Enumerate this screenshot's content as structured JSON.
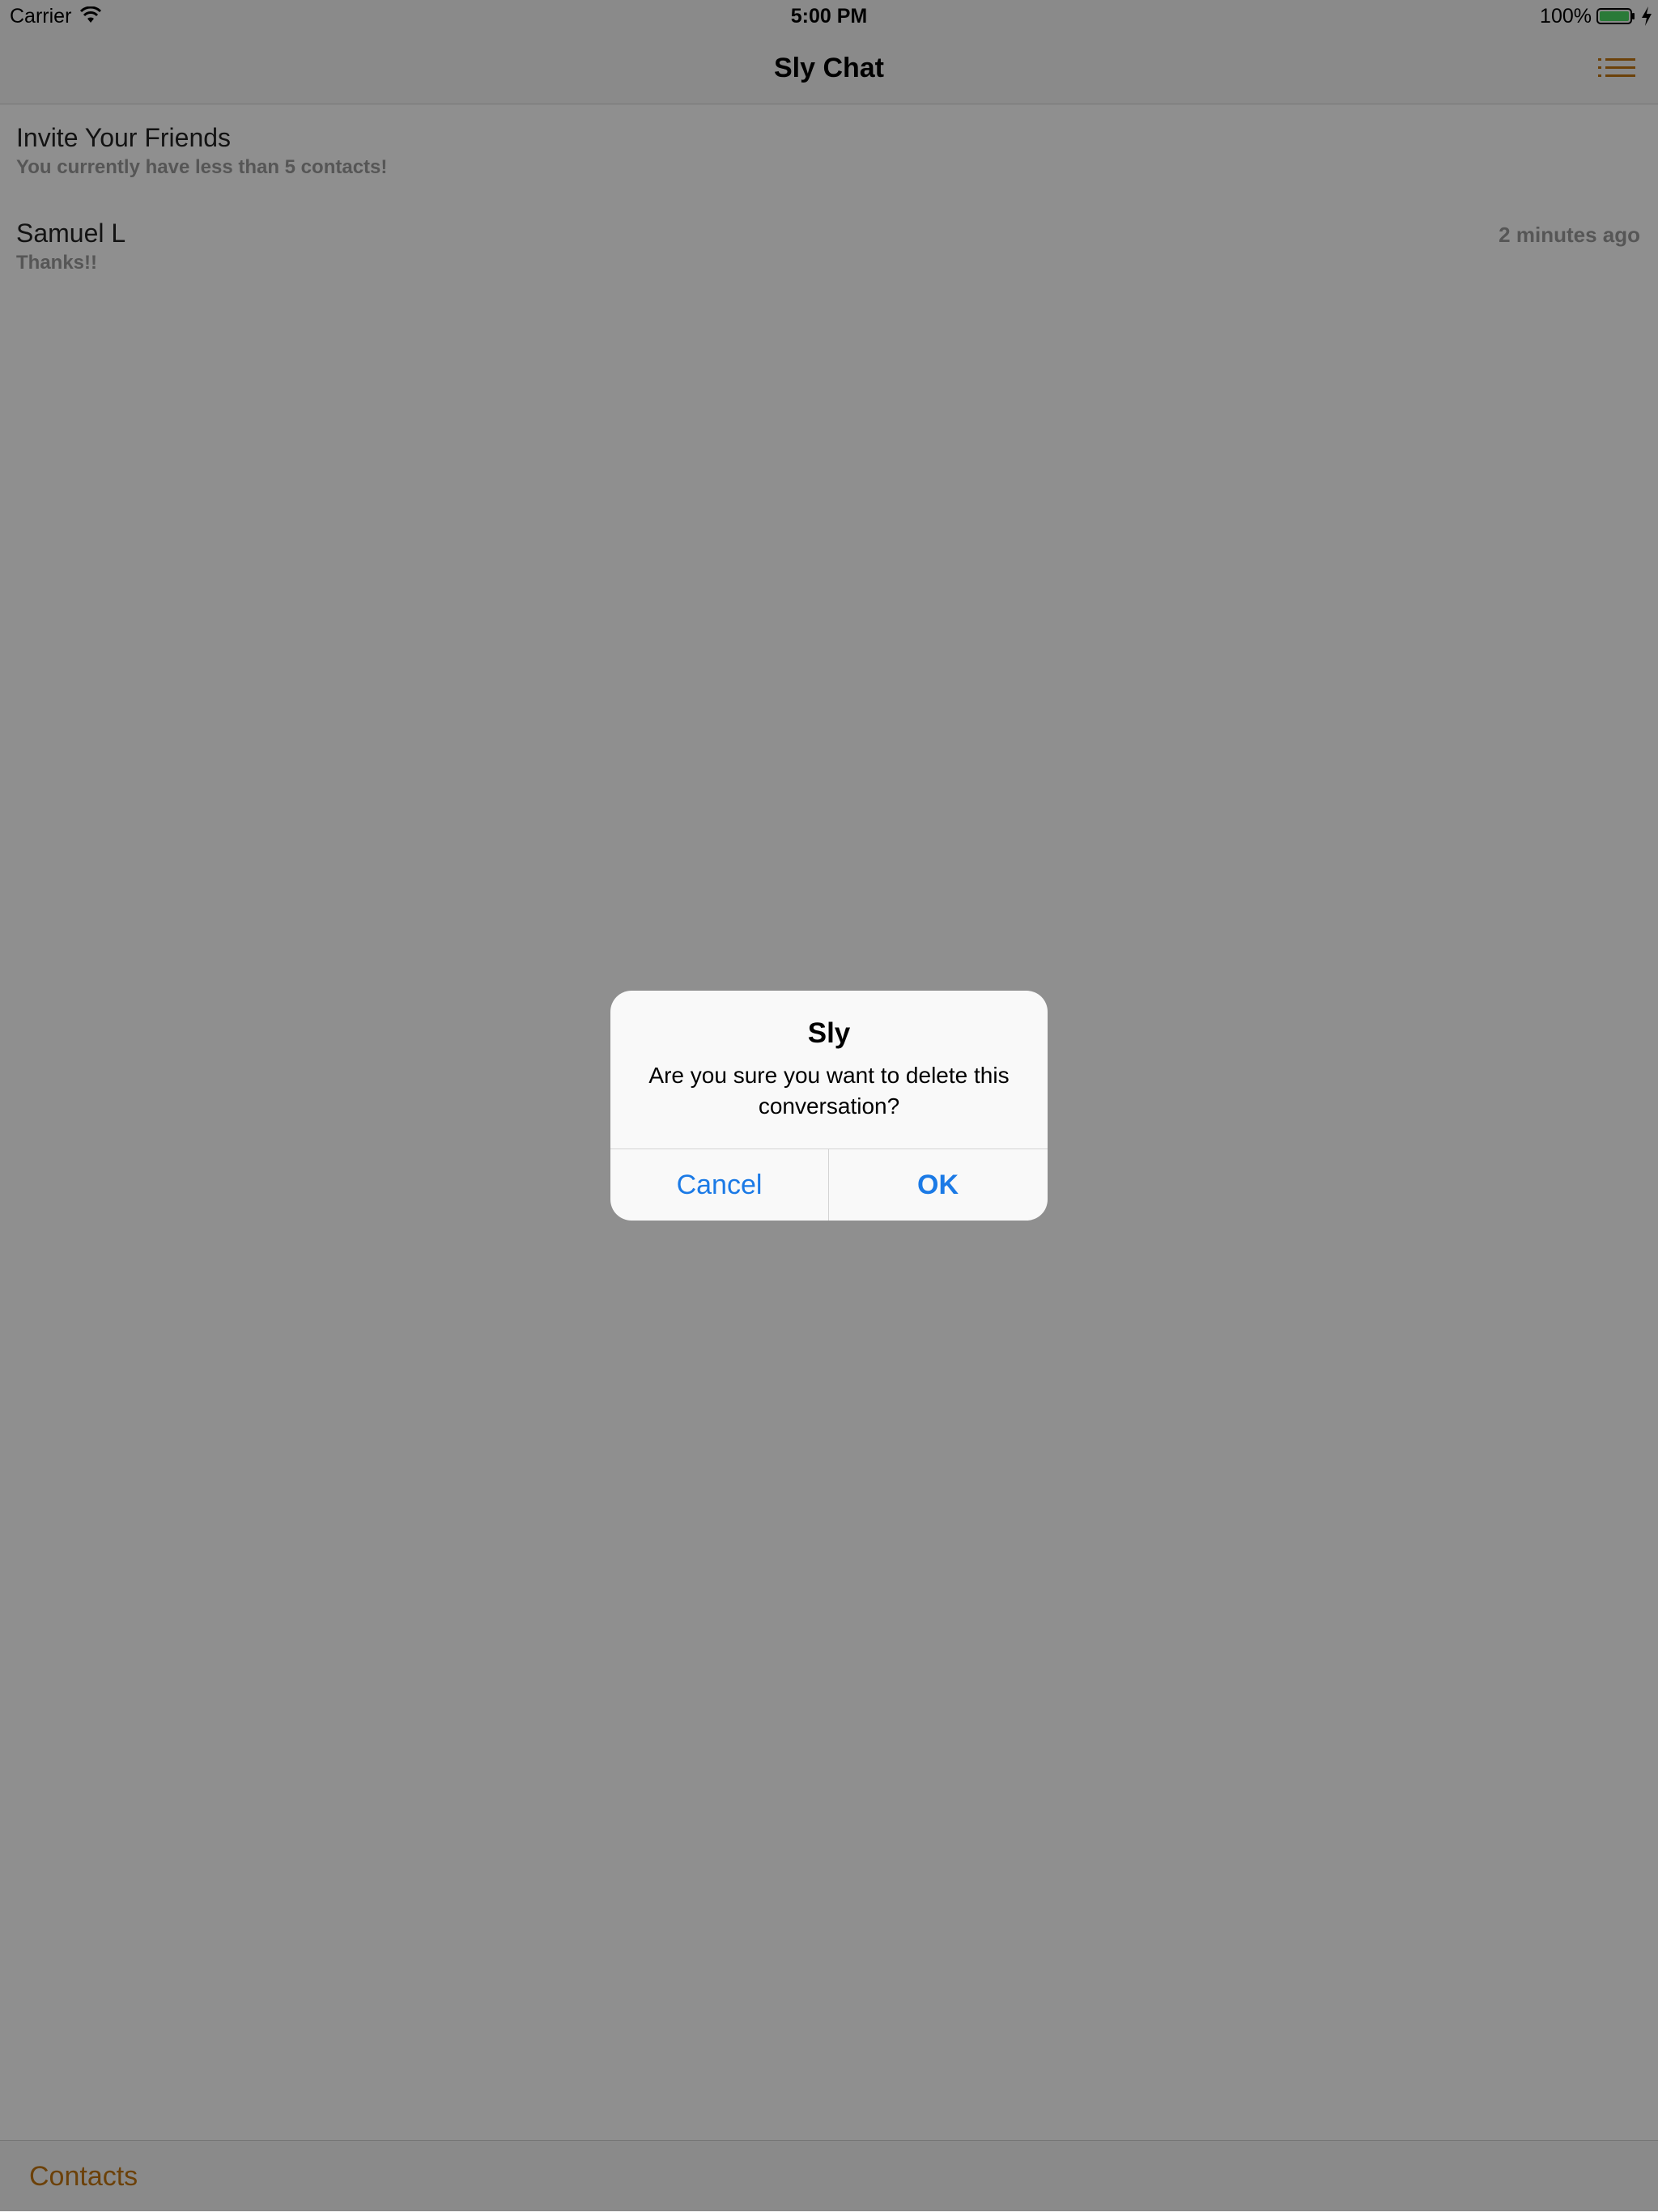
{
  "status_bar": {
    "carrier": "Carrier",
    "time": "5:00 PM",
    "battery_percent": "100%",
    "icons": [
      "wifi-icon",
      "battery-icon",
      "charging-bolt-icon"
    ]
  },
  "nav_bar": {
    "title": "Sly Chat",
    "menu_icon": "list-menu-icon"
  },
  "conversations": [
    {
      "title": "Invite Your Friends",
      "subtitle": "You currently have less than 5 contacts!",
      "time": ""
    },
    {
      "title": "Samuel L",
      "subtitle": "Thanks!!",
      "time": "2 minutes ago"
    }
  ],
  "bottom_bar": {
    "contacts_label": "Contacts"
  },
  "alert": {
    "title": "Sly",
    "message": "Are you sure you want to delete this conversation?",
    "cancel_label": "Cancel",
    "ok_label": "OK"
  },
  "colors": {
    "accent": "#c07410",
    "alert_button": "#1b7ae6",
    "battery_fill": "#4cd964"
  }
}
